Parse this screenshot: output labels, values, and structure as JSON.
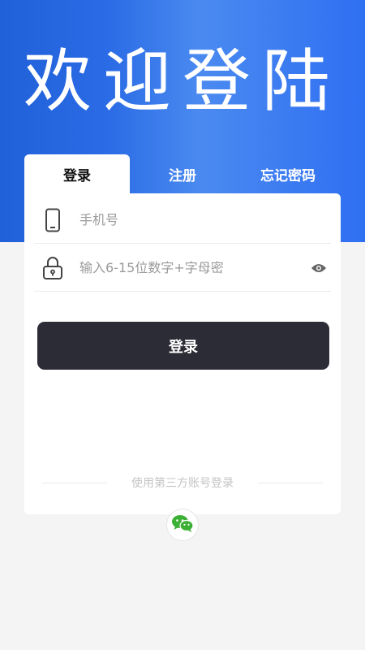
{
  "header": {
    "title": "欢迎登陆"
  },
  "tabs": [
    {
      "label": "登录",
      "active": true
    },
    {
      "label": "注册",
      "active": false
    },
    {
      "label": "忘记密码",
      "active": false
    }
  ],
  "form": {
    "phone": {
      "placeholder": "手机号",
      "icon": "phone-icon"
    },
    "password": {
      "placeholder": "输入6-15位数字+字母密",
      "icon": "lock-icon",
      "toggle_icon": "eye-icon"
    },
    "submit_label": "登录"
  },
  "third_party": {
    "label": "使用第三方账号登录",
    "providers": [
      "wechat-icon"
    ]
  },
  "colors": {
    "accent": "#2b6ce6",
    "button": "#2c2c36",
    "wechat": "#3cb035"
  }
}
